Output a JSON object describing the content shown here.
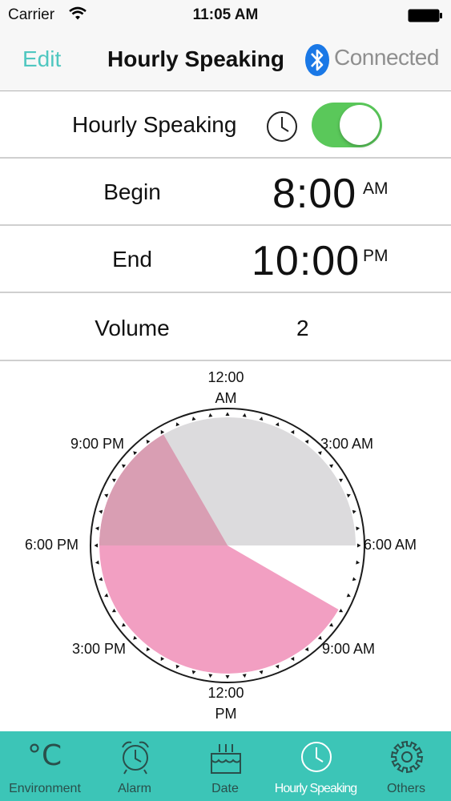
{
  "status_bar": {
    "carrier": "Carrier",
    "time": "11:05 AM"
  },
  "nav": {
    "edit_label": "Edit",
    "title": "Hourly Speaking",
    "bluetooth_status": "Connected",
    "accent": "#4fc7c0"
  },
  "settings": {
    "hourly_speaking_label": "Hourly Speaking",
    "hourly_speaking_on": true,
    "begin_label": "Begin",
    "begin_time": "8:00",
    "begin_ampm": "AM",
    "end_label": "End",
    "end_time": "10:00",
    "end_ampm": "PM",
    "volume_label": "Volume",
    "volume_value": "2"
  },
  "dial": {
    "labels": {
      "top_line1": "12:00",
      "top_line2": "AM",
      "three_am": "3:00 AM",
      "six_am": "6:00 AM",
      "nine_am": "9:00 AM",
      "bottom_line1": "12:00",
      "bottom_line2": "PM",
      "three_pm": "3:00 PM",
      "six_pm": "6:00 PM",
      "nine_pm": "9:00 PM"
    },
    "range_start_hour": 8,
    "range_end_hour": 22,
    "colors": {
      "inactive": "#dcdbdd",
      "active": "#f29fc2",
      "overlap": "#d99eb3"
    }
  },
  "tabs": [
    {
      "label": "Environment",
      "icon": "celsius-icon",
      "glyph": "°C",
      "active": false
    },
    {
      "label": "Alarm",
      "icon": "alarm-clock-icon",
      "active": false
    },
    {
      "label": "Date",
      "icon": "calendar-cake-icon",
      "active": false
    },
    {
      "label": "Hourly Speaking",
      "icon": "clock-icon",
      "active": true
    },
    {
      "label": "Others",
      "icon": "gear-icon",
      "active": false
    }
  ]
}
